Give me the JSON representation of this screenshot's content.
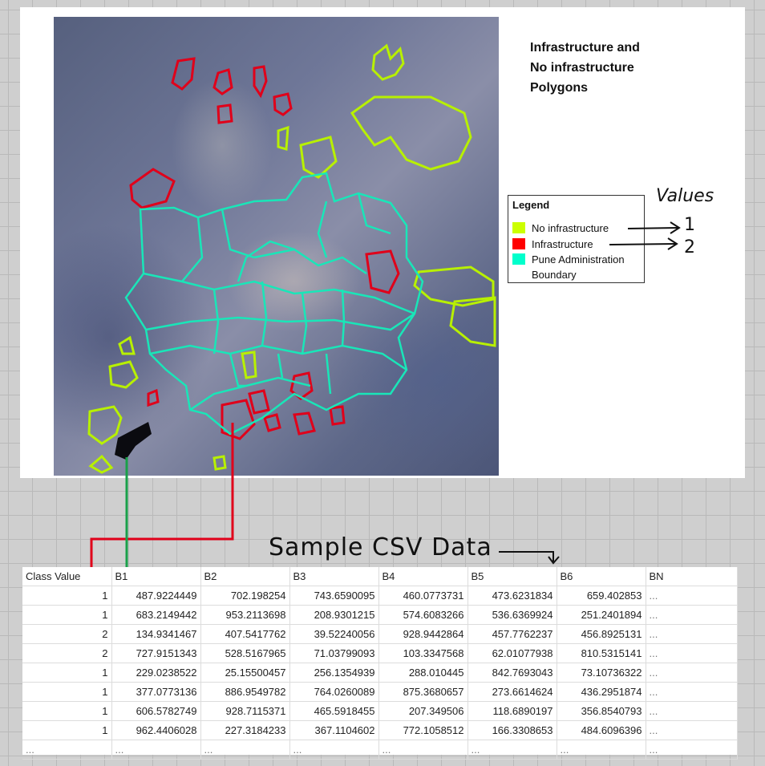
{
  "map": {
    "title_lines": [
      "Infrastructure and",
      "No infrastructure",
      "Polygons"
    ],
    "legend": {
      "title": "Legend",
      "items": [
        {
          "label": "No infrastructure",
          "color": "#ccff00"
        },
        {
          "label": "Infrastructure",
          "color": "#ff0000"
        },
        {
          "label": "Pune Administration",
          "label_line2": "Boundary",
          "color": "#00ffcc"
        }
      ]
    },
    "polygon_colors": {
      "no_infrastructure": "#b8f000",
      "infrastructure": "#e0001a",
      "boundary": "#19e6b8"
    }
  },
  "annotations": {
    "values_heading": "Values",
    "value_no_infrastructure": "1",
    "value_infrastructure": "2",
    "csv_caption": "Sample CSV Data",
    "leader_colors": {
      "red": "#e0001a",
      "green": "#1aa04a"
    }
  },
  "table": {
    "headers": [
      "Class Value",
      "B1",
      "B2",
      "B3",
      "B4",
      "B5",
      "B6",
      "BN"
    ],
    "rows": [
      [
        "1",
        "487.9224449",
        "702.198254",
        "743.6590095",
        "460.0773731",
        "473.6231834",
        "659.402853",
        "..."
      ],
      [
        "1",
        "683.2149442",
        "953.2113698",
        "208.9301215",
        "574.6083266",
        "536.6369924",
        "251.2401894",
        "..."
      ],
      [
        "2",
        "134.9341467",
        "407.5417762",
        "39.52240056",
        "928.9442864",
        "457.7762237",
        "456.8925131",
        "..."
      ],
      [
        "2",
        "727.9151343",
        "528.5167965",
        "71.03799093",
        "103.3347568",
        "62.01077938",
        "810.5315141",
        "..."
      ],
      [
        "1",
        "229.0238522",
        "25.15500457",
        "256.1354939",
        "288.010445",
        "842.7693043",
        "73.10736322",
        "..."
      ],
      [
        "1",
        "377.0773136",
        "886.9549782",
        "764.0260089",
        "875.3680657",
        "273.6614624",
        "436.2951874",
        "..."
      ],
      [
        "1",
        "606.5782749",
        "928.7115371",
        "465.5918455",
        "207.349506",
        "118.6890197",
        "356.8540793",
        "..."
      ],
      [
        "1",
        "962.4406028",
        "227.3184233",
        "367.1104602",
        "772.1058512",
        "166.3308653",
        "484.6096396",
        "..."
      ],
      [
        "...",
        "...",
        "...",
        "...",
        "...",
        "...",
        "...",
        "..."
      ]
    ]
  }
}
